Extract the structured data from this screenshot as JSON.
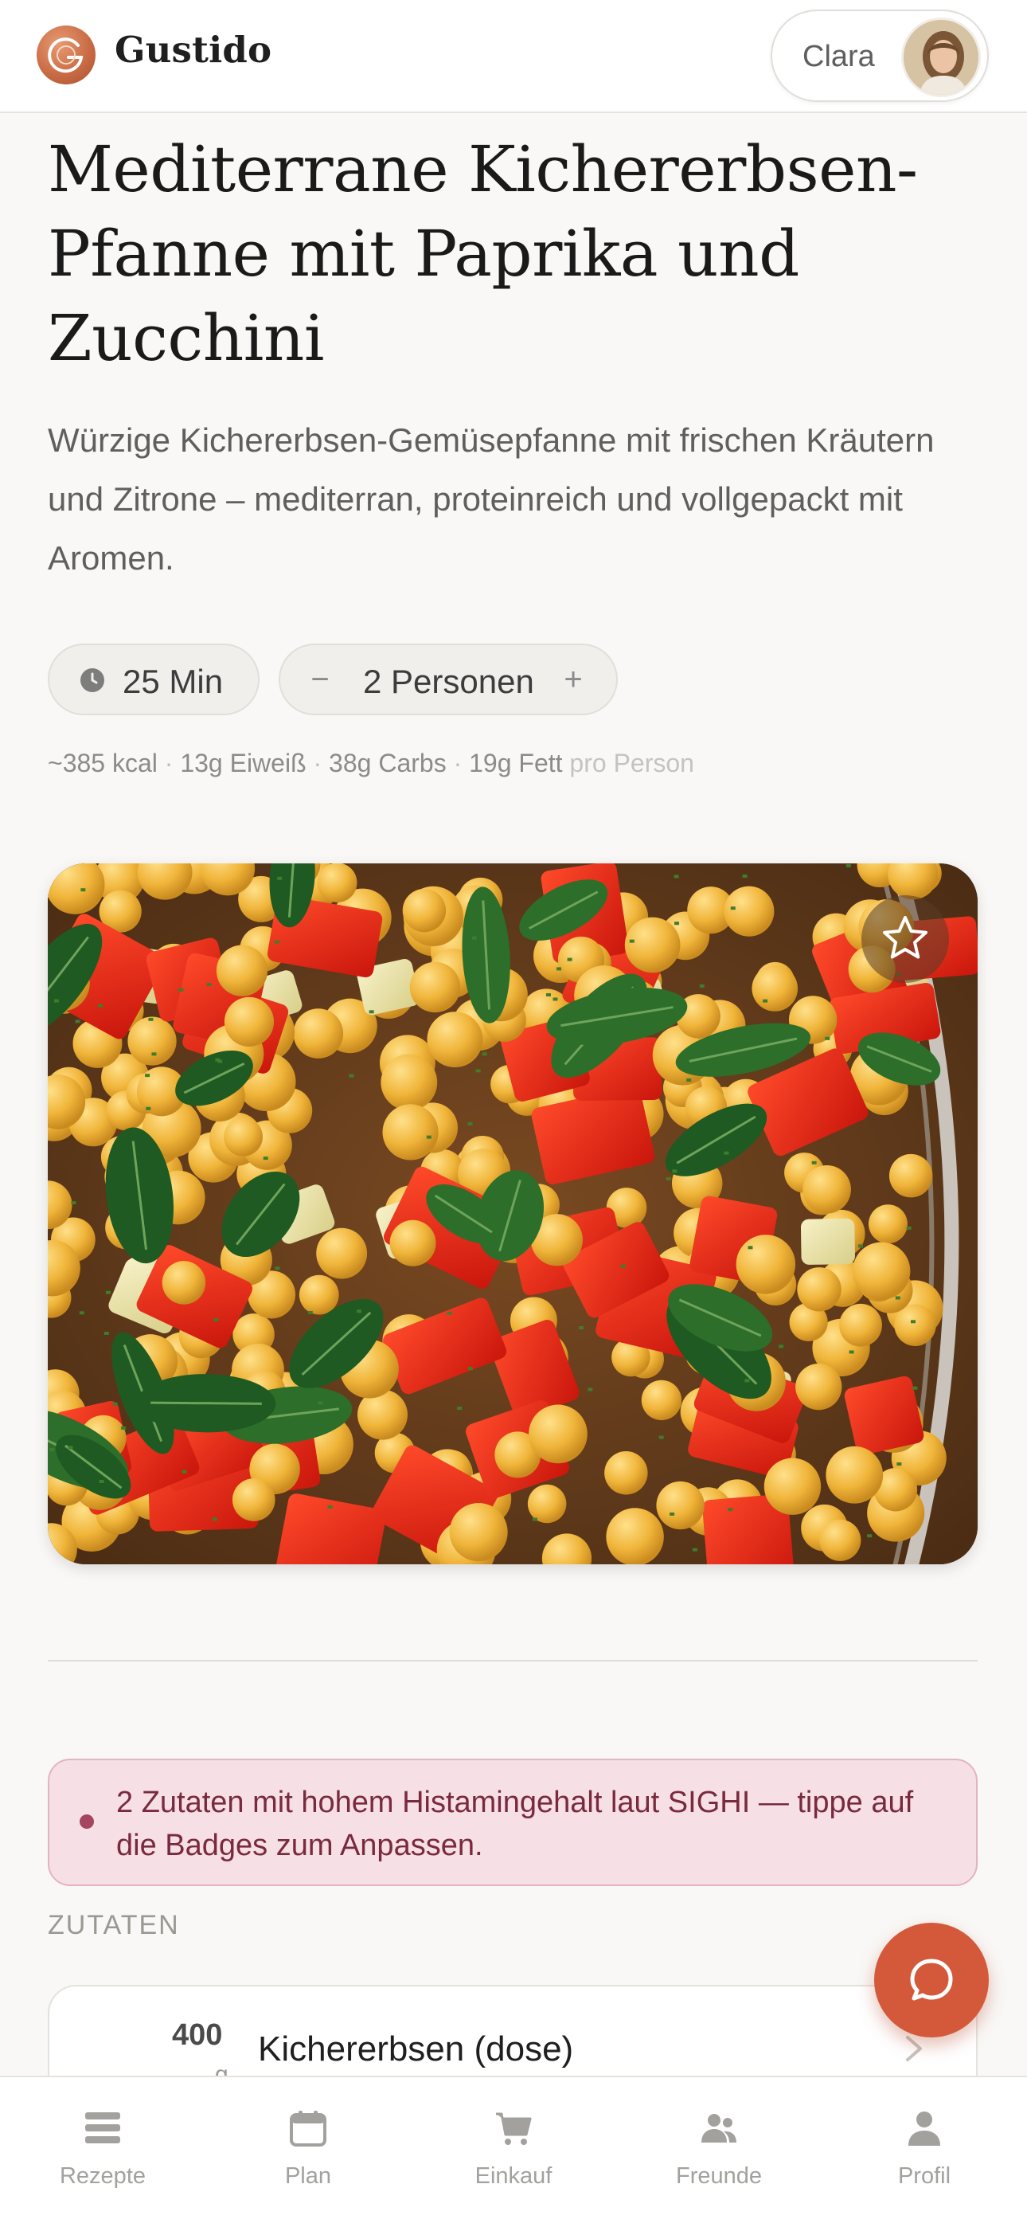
{
  "header": {
    "brand": "Gustido",
    "logo_icon": "gustido-logo-icon",
    "user_name": "Clara"
  },
  "recipe": {
    "title": "Mediterrane Kichererbsen-Pfanne mit Paprika und Zucchini",
    "description": "Würzige Kichererbsen-Gemüsepfanne mit frischen Kräutern und Zitrone – mediterran, proteinreich und vollgepackt mit Aromen.",
    "time": "25 Min",
    "servings": "2 Personen",
    "minus_label": "−",
    "plus_label": "+",
    "nutrition": {
      "kcal": "~385 kcal",
      "protein": "13g Eiweiß",
      "carbs": "38g Carbs",
      "fat": "19g Fett",
      "per_person": "pro Person",
      "separator": "·"
    }
  },
  "alert": {
    "text": "2 Zutaten mit hohem Histamingehalt laut SIGHI — tippe auf die Badges zum Anpassen.",
    "color": "#a5455f"
  },
  "ingredients": {
    "section_label": "ZUTATEN",
    "items": [
      {
        "qty": "400",
        "unit": "g",
        "name": "Kichererbsen (dose)"
      }
    ]
  },
  "bottom_nav": [
    {
      "label": "Rezepte",
      "icon": "recipes-list-icon"
    },
    {
      "label": "Plan",
      "icon": "calendar-icon"
    },
    {
      "label": "Einkauf",
      "icon": "shopping-cart-icon"
    },
    {
      "label": "Freunde",
      "icon": "friends-icon"
    },
    {
      "label": "Profil",
      "icon": "profile-icon"
    }
  ],
  "colors": {
    "accent": "#d4593a",
    "background": "#f9f8f6",
    "alert_bg": "#f6e0e5"
  }
}
